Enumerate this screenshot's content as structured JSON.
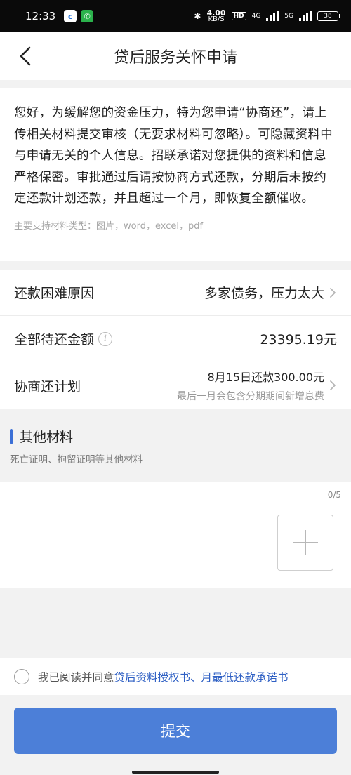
{
  "status_bar": {
    "time": "12:33",
    "app_icon_1": "c",
    "app_icon_2": "phone",
    "speed_value": "4.00",
    "speed_unit": "KB/S",
    "hd_label": "HD",
    "network_1": "4G",
    "network_2": "5G",
    "battery": "38"
  },
  "nav": {
    "title": "贷后服务关怀申请"
  },
  "intro": {
    "text": "您好，为缓解您的资金压力，特为您申请“协商还”，请上传相关材料提交审核（无要求材料可忽略）。可隐藏资料中与申请无关的个人信息。招联承诺对您提供的资料和信息严格保密。审批通过后请按协商方式还款，分期后未按约定还款计划还款，并且超过一个月，即恢复全额催收。",
    "supported_types": "主要支持材料类型：图片，word，excel，pdf"
  },
  "rows": {
    "reason_label": "还款困难原因",
    "reason_value": "多家债务，压力太大",
    "amount_label": "全部待还金额",
    "amount_value": "23395.19元",
    "plan_label": "协商还计划",
    "plan_main": "8月15日还款300.00元",
    "plan_sub": "最后一月会包含分期期间新增息费"
  },
  "other_materials": {
    "title": "其他材料",
    "description": "死亡证明、拘留证明等其他材料",
    "count": "0/5"
  },
  "agreement": {
    "prefix": "我已阅读并同意",
    "link_1": "贷后资料授权书",
    "separator": "、",
    "link_2": "月最低还款承诺书"
  },
  "submit_label": "提交",
  "colors": {
    "accent": "#3b6fd6",
    "button": "#4c7fd8",
    "link": "#2f60c4"
  }
}
